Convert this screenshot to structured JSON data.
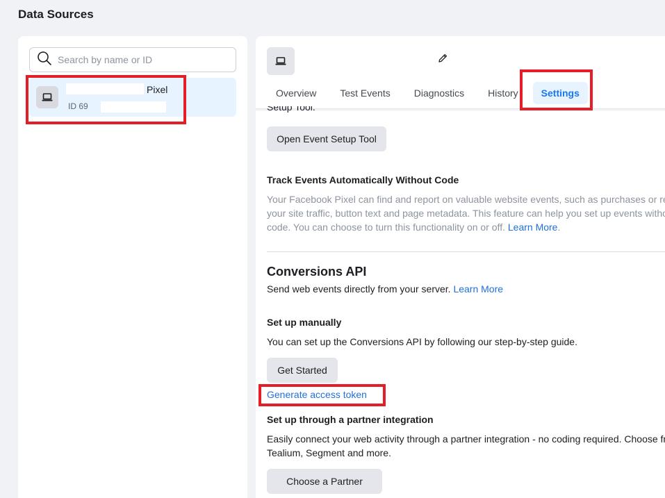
{
  "page_title": "Data Sources",
  "search": {
    "placeholder": "Search by name or ID",
    "icon": "search-icon"
  },
  "source_item": {
    "type_label": "Pixel",
    "id_prefix": "ID 69",
    "icon": "laptop-icon"
  },
  "header": {
    "icon": "laptop-icon",
    "edit_icon": "pencil-icon"
  },
  "tabs": [
    {
      "label": "Overview"
    },
    {
      "label": "Test Events"
    },
    {
      "label": "Diagnostics"
    },
    {
      "label": "History"
    },
    {
      "label": "Settings",
      "active": true
    }
  ],
  "event_setup": {
    "clipped_text": "Setup Tool.",
    "button_label": "Open Event Setup Tool"
  },
  "auto_track": {
    "heading": "Track Events Automatically Without Code",
    "line1": "Your Facebook Pixel can find and report on valuable website events, such as purchases or re",
    "line2": "your site traffic, button text and page metadata. This feature can help you set up events witho",
    "line3": "code. You can choose to turn this functionality on or off.",
    "learn_more": "Learn More",
    "period": "."
  },
  "conversions_api": {
    "title": "Conversions API",
    "description": "Send web events directly from your server.",
    "learn_more": "Learn More"
  },
  "setup_manually": {
    "heading": "Set up manually",
    "description": "You can set up the Conversions API by following our step-by-step guide.",
    "button_label": "Get Started",
    "token_link": "Generate access token"
  },
  "partner": {
    "heading": "Set up through a partner integration",
    "line1": "Easily connect your web activity through a partner integration - no coding required. Choose fr",
    "line2": "Tealium, Segment and more.",
    "button_label": "Choose a Partner"
  },
  "colors": {
    "accent": "#1877f2",
    "link": "#216fdb",
    "highlight": "#e41e26",
    "selected_bg": "#e7f3ff"
  }
}
